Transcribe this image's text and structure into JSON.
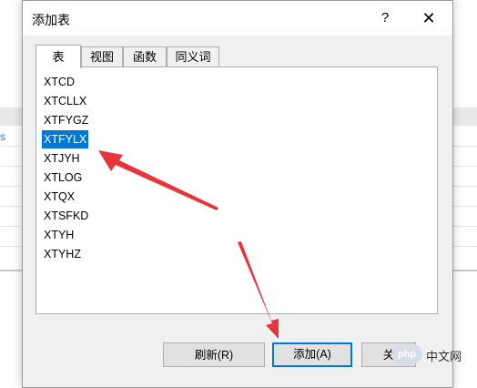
{
  "background": {
    "link_text": "s"
  },
  "dialog": {
    "title": "添加表",
    "help_label": "?",
    "close_label": "✕",
    "tabs": [
      {
        "label": "表"
      },
      {
        "label": "视图"
      },
      {
        "label": "函数"
      },
      {
        "label": "同义词"
      }
    ],
    "active_tab": "表",
    "items": [
      {
        "label": "XTCD"
      },
      {
        "label": "XTCLLX"
      },
      {
        "label": "XTFYGZ"
      },
      {
        "label": "XTFYLX"
      },
      {
        "label": "XTJYH"
      },
      {
        "label": "XTLOG"
      },
      {
        "label": "XTQX"
      },
      {
        "label": "XTSFKD"
      },
      {
        "label": "XTYH"
      },
      {
        "label": "XTYHZ"
      }
    ],
    "selected_item": "XTFYLX",
    "buttons": {
      "refresh_label": "刷新(R)",
      "add_label": "添加(A)",
      "close_label": "关"
    }
  },
  "watermark": {
    "logo_text": "php",
    "site_text": "中文网"
  },
  "colors": {
    "selection": "#0078d7",
    "arrow": "#e8343b",
    "dialog_bg": "#f0f0f0"
  }
}
